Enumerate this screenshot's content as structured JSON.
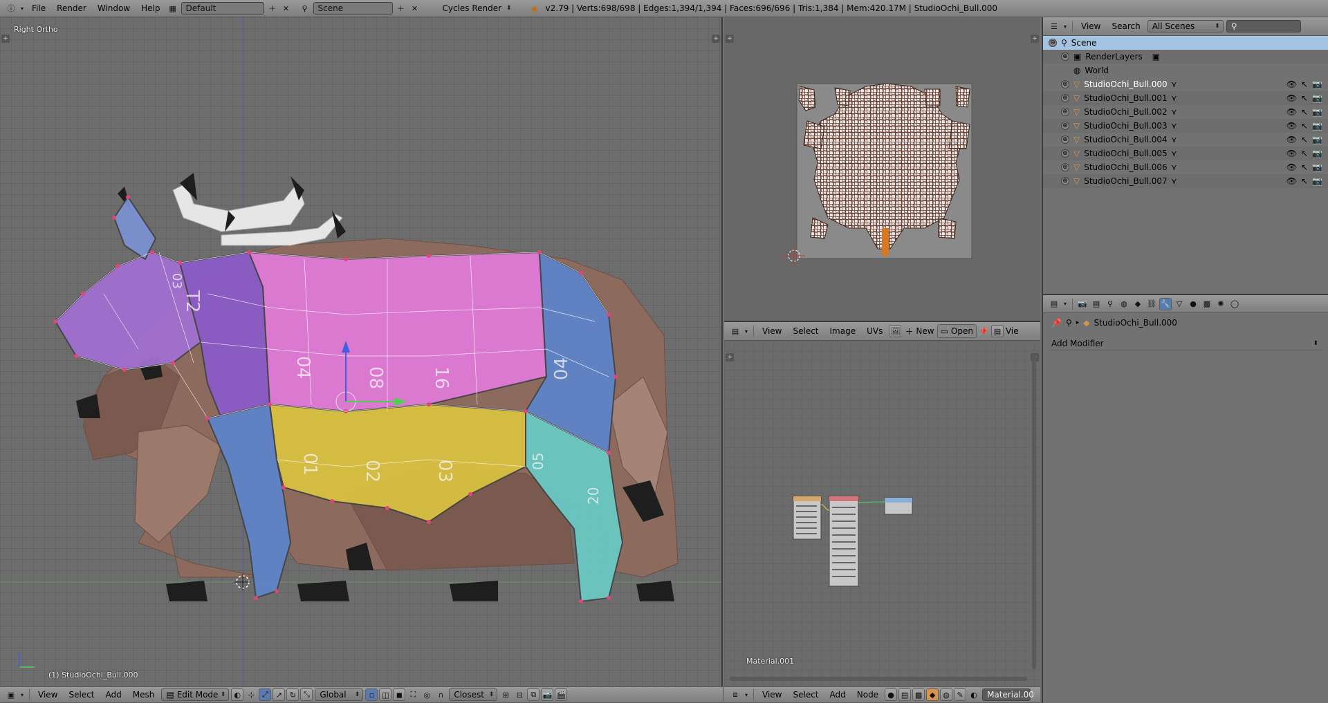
{
  "topbar": {
    "menus": [
      "File",
      "Render",
      "Window",
      "Help"
    ],
    "layout": "Default",
    "scene": "Scene",
    "engine": "Cycles Render",
    "stats": "v2.79 | Verts:698/698 | Edges:1,394/1,394 | Faces:696/696 | Tris:1,384 | Mem:420.17M | StudioOchi_Bull.000"
  },
  "viewport": {
    "view_label": "Right Ortho",
    "object_label": "(1) StudioOchi_Bull.000",
    "footer": {
      "menus": [
        "View",
        "Select",
        "Add",
        "Mesh"
      ],
      "mode": "Edit Mode",
      "orientation": "Global",
      "snap": "Closest"
    },
    "patch_numbers": [
      "T2",
      "03",
      "04",
      "08",
      "16",
      "04",
      "01",
      "02",
      "03",
      "05",
      "20"
    ]
  },
  "uv_editor": {
    "header": {
      "menus": [
        "View",
        "Select",
        "Image",
        "UVs"
      ],
      "new_label": "New",
      "open_label": "Open",
      "view_truncated": "Vie"
    }
  },
  "node_editor": {
    "material_label": "Material.001",
    "header": {
      "menus": [
        "View",
        "Select",
        "Add",
        "Node"
      ],
      "material_field": "Material.00"
    }
  },
  "outliner": {
    "header": {
      "view": "View",
      "search": "Search",
      "filter": "All Scenes"
    },
    "scene": "Scene",
    "render_layers": "RenderLayers",
    "world": "World",
    "objects": [
      "StudioOchi_Bull.000",
      "StudioOchi_Bull.001",
      "StudioOchi_Bull.002",
      "StudioOchi_Bull.003",
      "StudioOchi_Bull.004",
      "StudioOchi_Bull.005",
      "StudioOchi_Bull.006",
      "StudioOchi_Bull.007"
    ]
  },
  "properties": {
    "object_name": "StudioOchi_Bull.000",
    "add_modifier": "Add Modifier"
  },
  "colors": {
    "header_bg": "#8a8a8a",
    "selection_blue": "#a3c3e0",
    "vertex_pink": "#e0457c",
    "uv_patch_purple": "#a070d0",
    "uv_patch_pink": "#e07ad8",
    "uv_patch_yellow": "#d8c040",
    "uv_patch_blue": "#5f84c8",
    "uv_patch_teal": "#6ac8c4",
    "cow_brown": "#9a7466"
  }
}
